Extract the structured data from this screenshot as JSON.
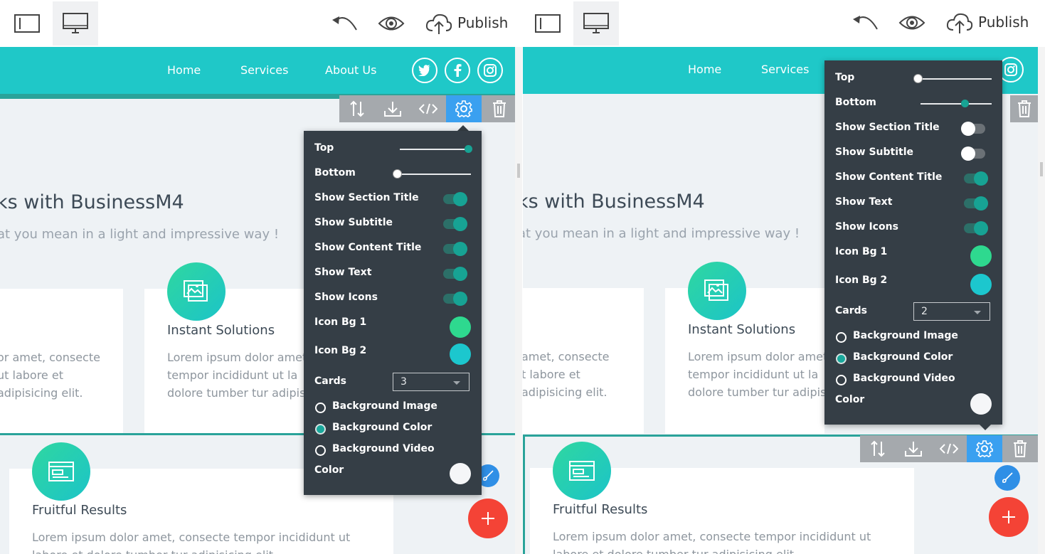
{
  "colors": {
    "accent": "#1fc8c8",
    "panel_bg": "#353e46",
    "toggle_on": "#17a394",
    "icon_bg_1": "#2ed98f",
    "icon_bg_2": "#1cc7ce",
    "fab_add": "#f44336",
    "fab_edit": "#2f8fe6",
    "tool_active": "#3aa0f0"
  },
  "topbar": {
    "publish_label": "Publish",
    "icons": [
      "sidebar-toggle-icon",
      "desktop-view-icon",
      "undo-icon",
      "preview-eye-icon",
      "cloud-upload-icon"
    ]
  },
  "site": {
    "nav": [
      "Home",
      "Services",
      "About Us"
    ],
    "social_icons": [
      "twitter-icon",
      "facebook-icon",
      "instagram-icon"
    ],
    "headline": "ks with BusinessM4",
    "subheadline": "at you mean in a light and impressive way !",
    "card_left_text": [
      "or amet, consecte",
      "ut labore et",
      "adipisicing elit."
    ],
    "card_left_text_right": [
      "amet, consecte",
      "t labore et",
      "adipisicing elit."
    ],
    "card_instant": {
      "title": "Instant Solutions",
      "text": [
        "Lorem ipsum dolor amet",
        "tempor incididunt ut la",
        "dolore tumber tur adipisi"
      ]
    },
    "card_fruitful": {
      "title": "Fruitful Results",
      "text": [
        "Lorem ipsum dolor amet, consecte tempor incididunt ut",
        "labore et dolore tumber tur adipisicing elit."
      ]
    }
  },
  "block_toolbar": [
    "reorder-icon",
    "download-icon",
    "code-icon",
    "gear-icon",
    "trash-icon"
  ],
  "settings_left": {
    "top_label": "Top",
    "top_value": 1.0,
    "bottom_label": "Bottom",
    "bottom_value": 0.0,
    "show_section_title": {
      "label": "Show Section Title",
      "on": true
    },
    "show_subtitle": {
      "label": "Show Subtitle",
      "on": true
    },
    "show_content_title": {
      "label": "Show Content Title",
      "on": true
    },
    "show_text": {
      "label": "Show Text",
      "on": true
    },
    "show_icons": {
      "label": "Show Icons",
      "on": true
    },
    "icon_bg_1_label": "Icon Bg 1",
    "icon_bg_2_label": "Icon Bg 2",
    "cards_label": "Cards",
    "cards_value": "3",
    "bg_image": "Background Image",
    "bg_color": "Background Color",
    "bg_video": "Background Video",
    "selected_bg": "Background Color",
    "color_label": "Color"
  },
  "settings_right": {
    "top_label": "Top",
    "top_value": 0.0,
    "bottom_label": "Bottom",
    "bottom_value": 0.62,
    "show_section_title": {
      "label": "Show Section Title",
      "on": false
    },
    "show_subtitle": {
      "label": "Show Subtitle",
      "on": false
    },
    "show_content_title": {
      "label": "Show Content Title",
      "on": true
    },
    "show_text": {
      "label": "Show Text",
      "on": true
    },
    "show_icons": {
      "label": "Show Icons",
      "on": true
    },
    "icon_bg_1_label": "Icon Bg 1",
    "icon_bg_2_label": "Icon Bg 2",
    "cards_label": "Cards",
    "cards_value": "2",
    "bg_image": "Background Image",
    "bg_color": "Background Color",
    "bg_video": "Background Video",
    "selected_bg": "Background Color",
    "color_label": "Color"
  }
}
